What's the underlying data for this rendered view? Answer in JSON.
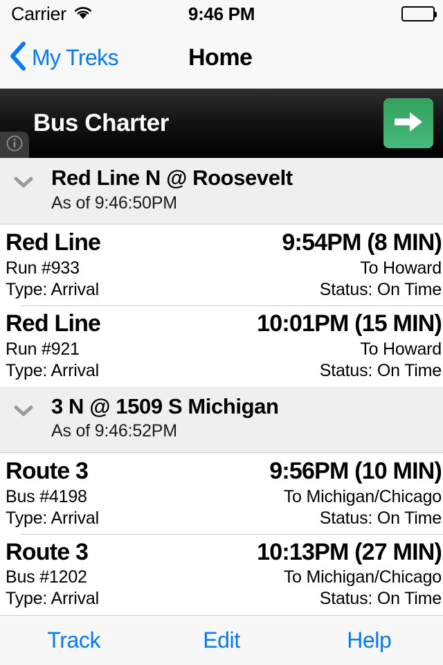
{
  "status_bar": {
    "carrier": "Carrier",
    "time": "9:46 PM",
    "wifi_icon": "wifi-icon",
    "battery_icon": "battery-full-icon"
  },
  "nav_bar": {
    "back_label": "My Treks",
    "back_icon": "chevron-left-icon",
    "title": "Home"
  },
  "ad_banner": {
    "title": "Bus Charter",
    "cta_icon": "arrow-right-icon",
    "info_icon": "info-circle-icon",
    "cta_color": "#3cb371",
    "background_color": "#000000"
  },
  "sections": [
    {
      "chevron_icon": "chevron-down-icon",
      "title": "Red Line N @ Roosevelt",
      "subtitle": "As of 9:46:50PM",
      "arrivals": [
        {
          "route": "Red Line",
          "eta": "9:54PM (8 MIN)",
          "vehicle": "Run #933",
          "destination": "To Howard",
          "type": "Type: Arrival",
          "status": "Status: On Time"
        },
        {
          "route": "Red Line",
          "eta": "10:01PM (15 MIN)",
          "vehicle": "Run #921",
          "destination": "To Howard",
          "type": "Type: Arrival",
          "status": "Status: On Time"
        }
      ]
    },
    {
      "chevron_icon": "chevron-down-icon",
      "title": "3 N @ 1509 S Michigan",
      "subtitle": "As of 9:46:52PM",
      "arrivals": [
        {
          "route": "Route 3",
          "eta": "9:56PM (10 MIN)",
          "vehicle": "Bus #4198",
          "destination": "To Michigan/Chicago",
          "type": "Type: Arrival",
          "status": "Status: On Time"
        },
        {
          "route": "Route 3",
          "eta": "10:13PM (27 MIN)",
          "vehicle": "Bus #1202",
          "destination": "To Michigan/Chicago",
          "type": "Type: Arrival",
          "status": "Status: On Time"
        }
      ]
    }
  ],
  "toolbar": {
    "track_label": "Track",
    "edit_label": "Edit",
    "help_label": "Help",
    "tint_color": "#007aff"
  }
}
